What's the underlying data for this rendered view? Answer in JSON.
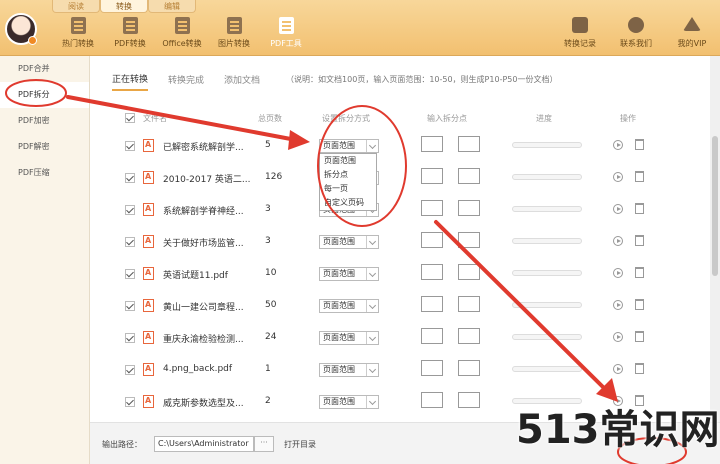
{
  "top_tabs": [
    "阅读",
    "转换",
    "编辑"
  ],
  "tools": [
    "热门转换",
    "PDF转换",
    "Office转换",
    "图片转换",
    "PDF工具"
  ],
  "right_tools": [
    "转换记录",
    "联系我们",
    "我的VIP"
  ],
  "sidebar": [
    "PDF合并",
    "PDF拆分",
    "PDF加密",
    "PDF解密",
    "PDF压缩"
  ],
  "content_tabs": [
    "正在转换",
    "转换完成",
    "添加文档"
  ],
  "note": "（说明：如文档100页，输入页面范围：10-50，则生成P10-P50一份文档）",
  "columns": {
    "filename": "文件名",
    "pages": "总页数",
    "mode": "设置拆分方式",
    "split_point": "输入拆分点",
    "progress": "进度",
    "action": "操作"
  },
  "files": [
    {
      "name": "已解密系统解剖学...",
      "pages": "5",
      "mode": "页面范围"
    },
    {
      "name": "2010-2017 英语二...",
      "pages": "126",
      "mode": "页面范围"
    },
    {
      "name": "系统解剖学脊神经...",
      "pages": "3",
      "mode": "页面范围"
    },
    {
      "name": "关于做好市场监管...",
      "pages": "3",
      "mode": "页面范围"
    },
    {
      "name": "英语试题11.pdf",
      "pages": "10",
      "mode": "页面范围"
    },
    {
      "name": "黄山一建公司章程...",
      "pages": "50",
      "mode": "页面范围"
    },
    {
      "name": "重庆永渝检验检测...",
      "pages": "24",
      "mode": "页面范围"
    },
    {
      "name": "4.png_back.pdf",
      "pages": "1",
      "mode": "页面范围"
    },
    {
      "name": "威克斯参数选型及...",
      "pages": "2",
      "mode": "页面范围"
    }
  ],
  "dropdown_options": [
    "页面范围",
    "拆分点",
    "每一页",
    "自定义页码"
  ],
  "bottom": {
    "output_label": "输出路径：",
    "output_value": "C:\\Users\\Administrator",
    "dots": "···",
    "open_dir": "打开目录"
  },
  "watermark": "513常识网",
  "colors": {
    "accent": "#f2c070",
    "annotation": "#e03a2e"
  }
}
